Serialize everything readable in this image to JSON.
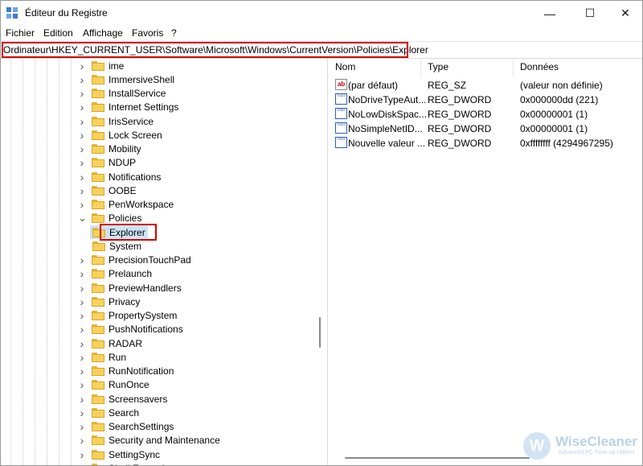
{
  "window": {
    "title": "Éditeur du Registre",
    "minimize_glyph": "—",
    "maximize_glyph": "☐",
    "close_glyph": "✕"
  },
  "menu": [
    "Fichier",
    "Edition",
    "Affichage",
    "Favoris",
    "?"
  ],
  "address": "Ordinateur\\HKEY_CURRENT_USER\\Software\\Microsoft\\Windows\\CurrentVersion\\Policies\\Explorer",
  "tree": {
    "items": [
      {
        "label": "ime",
        "expander": "collapsed"
      },
      {
        "label": "ImmersiveShell",
        "expander": "collapsed"
      },
      {
        "label": "InstallService",
        "expander": "collapsed"
      },
      {
        "label": "Internet Settings",
        "expander": "collapsed"
      },
      {
        "label": "IrisService",
        "expander": "collapsed"
      },
      {
        "label": "Lock Screen",
        "expander": "collapsed"
      },
      {
        "label": "Mobility",
        "expander": "collapsed"
      },
      {
        "label": "NDUP",
        "expander": "collapsed"
      },
      {
        "label": "Notifications",
        "expander": "collapsed"
      },
      {
        "label": "OOBE",
        "expander": "collapsed"
      },
      {
        "label": "PenWorkspace",
        "expander": "collapsed"
      },
      {
        "label": "Policies",
        "expander": "expanded"
      },
      {
        "label": "Explorer",
        "expander": "none",
        "selected": true
      },
      {
        "label": "System",
        "expander": "none"
      },
      {
        "label": "PrecisionTouchPad",
        "expander": "collapsed"
      },
      {
        "label": "Prelaunch",
        "expander": "collapsed"
      },
      {
        "label": "PreviewHandlers",
        "expander": "collapsed"
      },
      {
        "label": "Privacy",
        "expander": "collapsed"
      },
      {
        "label": "PropertySystem",
        "expander": "collapsed"
      },
      {
        "label": "PushNotifications",
        "expander": "collapsed"
      },
      {
        "label": "RADAR",
        "expander": "collapsed"
      },
      {
        "label": "Run",
        "expander": "collapsed"
      },
      {
        "label": "RunNotification",
        "expander": "collapsed"
      },
      {
        "label": "RunOnce",
        "expander": "collapsed"
      },
      {
        "label": "Screensavers",
        "expander": "collapsed"
      },
      {
        "label": "Search",
        "expander": "collapsed"
      },
      {
        "label": "SearchSettings",
        "expander": "collapsed"
      },
      {
        "label": "Security and Maintenance",
        "expander": "collapsed"
      },
      {
        "label": "SettingSync",
        "expander": "collapsed"
      },
      {
        "label": "Shell Extensions",
        "expander": "collapsed"
      }
    ]
  },
  "values": {
    "headers": {
      "name": "Nom",
      "type": "Type",
      "data": "Données"
    },
    "rows": [
      {
        "icon": "string-value-icon",
        "icon_text": "ab",
        "name": "(par défaut)",
        "type": "REG_SZ",
        "data": "(valeur non définie)"
      },
      {
        "icon": "dword-value-icon",
        "icon_text": "010",
        "name": "NoDriveTypeAut...",
        "type": "REG_DWORD",
        "data": "0x000000dd (221)"
      },
      {
        "icon": "dword-value-icon",
        "icon_text": "010",
        "name": "NoLowDiskSpac...",
        "type": "REG_DWORD",
        "data": "0x00000001 (1)"
      },
      {
        "icon": "dword-value-icon",
        "icon_text": "010",
        "name": "NoSimpleNetID...",
        "type": "REG_DWORD",
        "data": "0x00000001 (1)"
      },
      {
        "icon": "dword-value-icon",
        "icon_text": "010",
        "name": "Nouvelle valeur ...",
        "type": "REG_DWORD",
        "data": "0xffffffff (4294967295)"
      }
    ]
  },
  "watermark": {
    "initial": "W",
    "name": "WiseCleaner",
    "tagline": "Advanced PC Tune-up Utilities"
  },
  "colors": {
    "highlight": "#d20000",
    "selection": "#cce4f7",
    "folder": "#f7d25a"
  }
}
